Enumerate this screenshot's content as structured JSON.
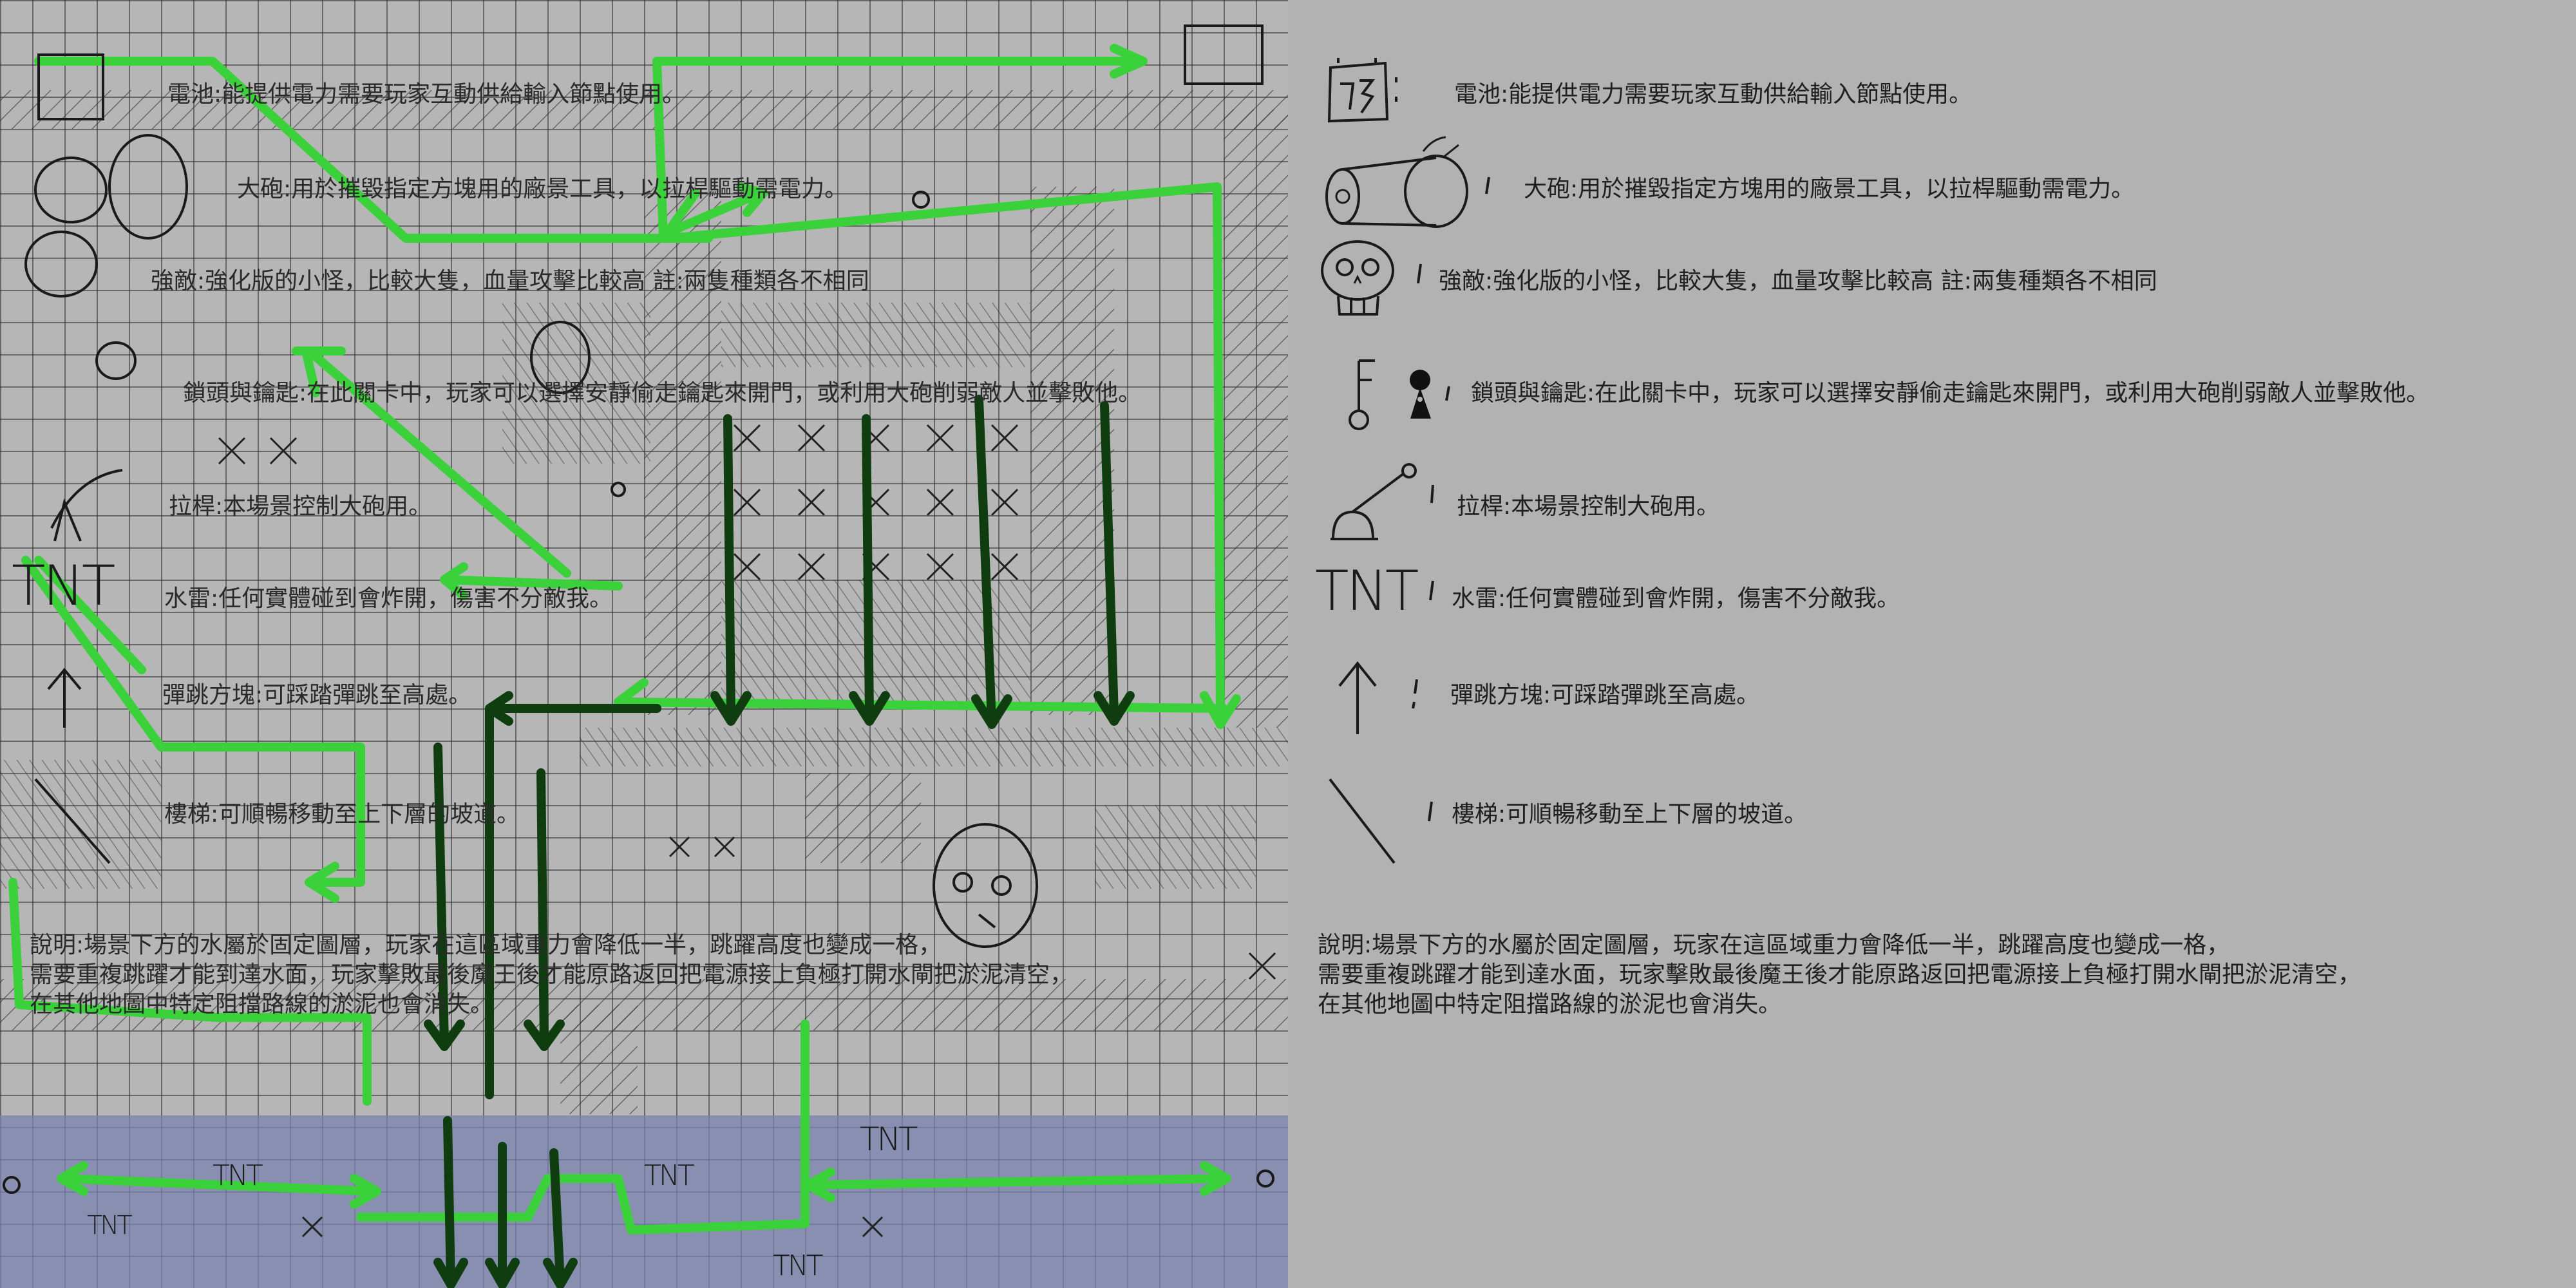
{
  "legend": {
    "items": [
      {
        "icon": "battery-icon",
        "label": "電池:能提供電力需要玩家互動供給輸入節點使用。"
      },
      {
        "icon": "cannon-icon",
        "label": "大砲:用於摧毀指定方塊用的廠景工具，以拉桿驅動需電力。"
      },
      {
        "icon": "skull-icon",
        "label": "強敵:強化版的小怪，比較大隻，血量攻擊比較高 註:兩隻種類各不相同"
      },
      {
        "icon": "key-and-lock-icon",
        "label": "鎖頭與鑰匙:在此關卡中，玩家可以選擇安靜偷走鑰匙來開門，或利用大砲削弱敵人並擊敗他。"
      },
      {
        "icon": "lever-icon",
        "label": "拉桿:本場景控制大砲用。"
      },
      {
        "icon": "tnt-icon",
        "label": "水雷:任何實體碰到會炸開，傷害不分敵我。"
      },
      {
        "icon": "up-arrow-icon",
        "label": "彈跳方塊:可踩踏彈跳至高處。"
      },
      {
        "icon": "stairs-icon",
        "label": "樓梯:可順暢移動至上下層的坡道。"
      }
    ],
    "tnt_glyph": "TNT",
    "note_lines": [
      "說明:場景下方的水屬於固定圖層，玩家在這區域重力會降低一半，跳躍高度也變成一格，",
      "需要重複跳躍才能到達水面，玩家擊敗最後魔王後才能原路返回把電源接上負極打開水閘把淤泥清空，",
      "在其他地圖中特定阻擋路線的淤泥也會消失。"
    ]
  },
  "map": {
    "tnt_labels": [
      "TNT",
      "TNT",
      "TNT",
      "TNT",
      "TNT",
      "TNT"
    ],
    "colors": {
      "path": "#3ad13a",
      "dark_path": "#0f3d10",
      "water": "#7882af",
      "ink": "#1a1a1a"
    }
  }
}
